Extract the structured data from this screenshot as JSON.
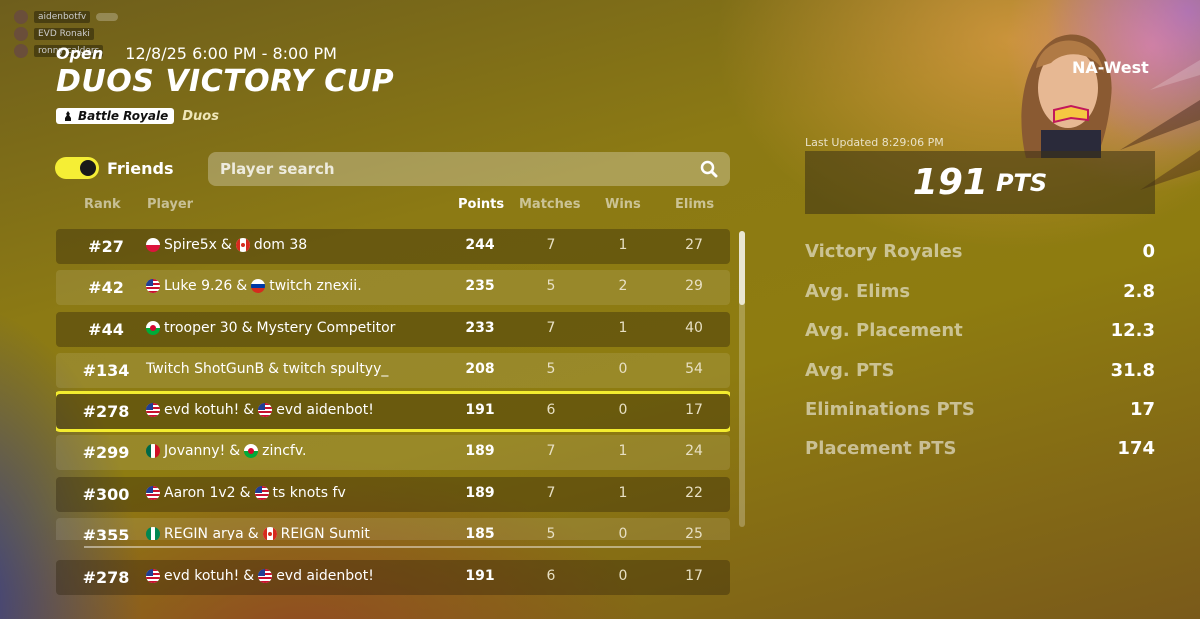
{
  "overlay": {
    "users": [
      {
        "name": "aidenbotfv"
      },
      {
        "name": "EVD Ronaki"
      },
      {
        "name": "ronny calders"
      }
    ]
  },
  "header": {
    "status": "Open",
    "time": "12/8/25 6:00 PM - 8:00 PM",
    "title": "Duos Victory Cup",
    "mode_badge": "Battle Royale",
    "mode_sub": "Duos"
  },
  "filters": {
    "friends_label": "Friends",
    "search_placeholder": "Player search"
  },
  "table": {
    "headers": {
      "rank": "Rank",
      "player": "Player",
      "points": "Points",
      "matches": "Matches",
      "wins": "Wins",
      "elims": "Elims"
    },
    "rows": [
      {
        "rank": "#27",
        "p1": "Spire5x",
        "f1": "poland",
        "p2": "dom 38",
        "f2": "canada",
        "points": "244",
        "matches": "7",
        "wins": "1",
        "elims": "27"
      },
      {
        "rank": "#42",
        "p1": "Luke 9.26",
        "f1": "usa",
        "p2": "twitch znexii.",
        "f2": "russia",
        "points": "235",
        "matches": "5",
        "wins": "2",
        "elims": "29"
      },
      {
        "rank": "#44",
        "p1": "trooper 30",
        "f1": "wales",
        "p2": "Mystery Competitor",
        "f2": "",
        "points": "233",
        "matches": "7",
        "wins": "1",
        "elims": "40"
      },
      {
        "rank": "#134",
        "p1": "Twitch ShotGunB",
        "f1": "",
        "p2": "twitch spultyy_",
        "f2": "",
        "points": "208",
        "matches": "5",
        "wins": "0",
        "elims": "54"
      },
      {
        "rank": "#278",
        "p1": "evd kotuh!",
        "f1": "usa",
        "p2": "evd aidenbot!",
        "f2": "usa",
        "points": "191",
        "matches": "6",
        "wins": "0",
        "elims": "17"
      },
      {
        "rank": "#299",
        "p1": "Jovanny!",
        "f1": "mexico",
        "p2": "zincfv.",
        "f2": "wales",
        "points": "189",
        "matches": "7",
        "wins": "1",
        "elims": "24"
      },
      {
        "rank": "#300",
        "p1": "Aaron 1v2",
        "f1": "usa",
        "p2": "ts knots fv",
        "f2": "usa",
        "points": "189",
        "matches": "7",
        "wins": "1",
        "elims": "22"
      },
      {
        "rank": "#355",
        "p1": "REGIN arya",
        "f1": "nigeria",
        "p2": "REIGN Sumit",
        "f2": "canada",
        "points": "185",
        "matches": "5",
        "wins": "0",
        "elims": "25"
      }
    ],
    "pinned": {
      "rank": "#278",
      "p1": "evd kotuh!",
      "f1": "usa",
      "p2": "evd aidenbot!",
      "f2": "usa",
      "points": "191",
      "matches": "6",
      "wins": "0",
      "elims": "17"
    },
    "highlight_index": 4
  },
  "panel": {
    "region": "NA-West",
    "last_updated": "Last Updated 8:29:06 PM",
    "points": "191",
    "points_unit": "PTS",
    "stats": [
      {
        "label": "Victory Royales",
        "value": "0"
      },
      {
        "label": "Avg. Elims",
        "value": "2.8"
      },
      {
        "label": "Avg. Placement",
        "value": "12.3"
      },
      {
        "label": "Avg. PTS",
        "value": "31.8"
      },
      {
        "label": "Eliminations PTS",
        "value": "17"
      },
      {
        "label": "Placement PTS",
        "value": "174"
      }
    ]
  },
  "colors": {
    "accent_yellow": "#f3ec2f"
  }
}
